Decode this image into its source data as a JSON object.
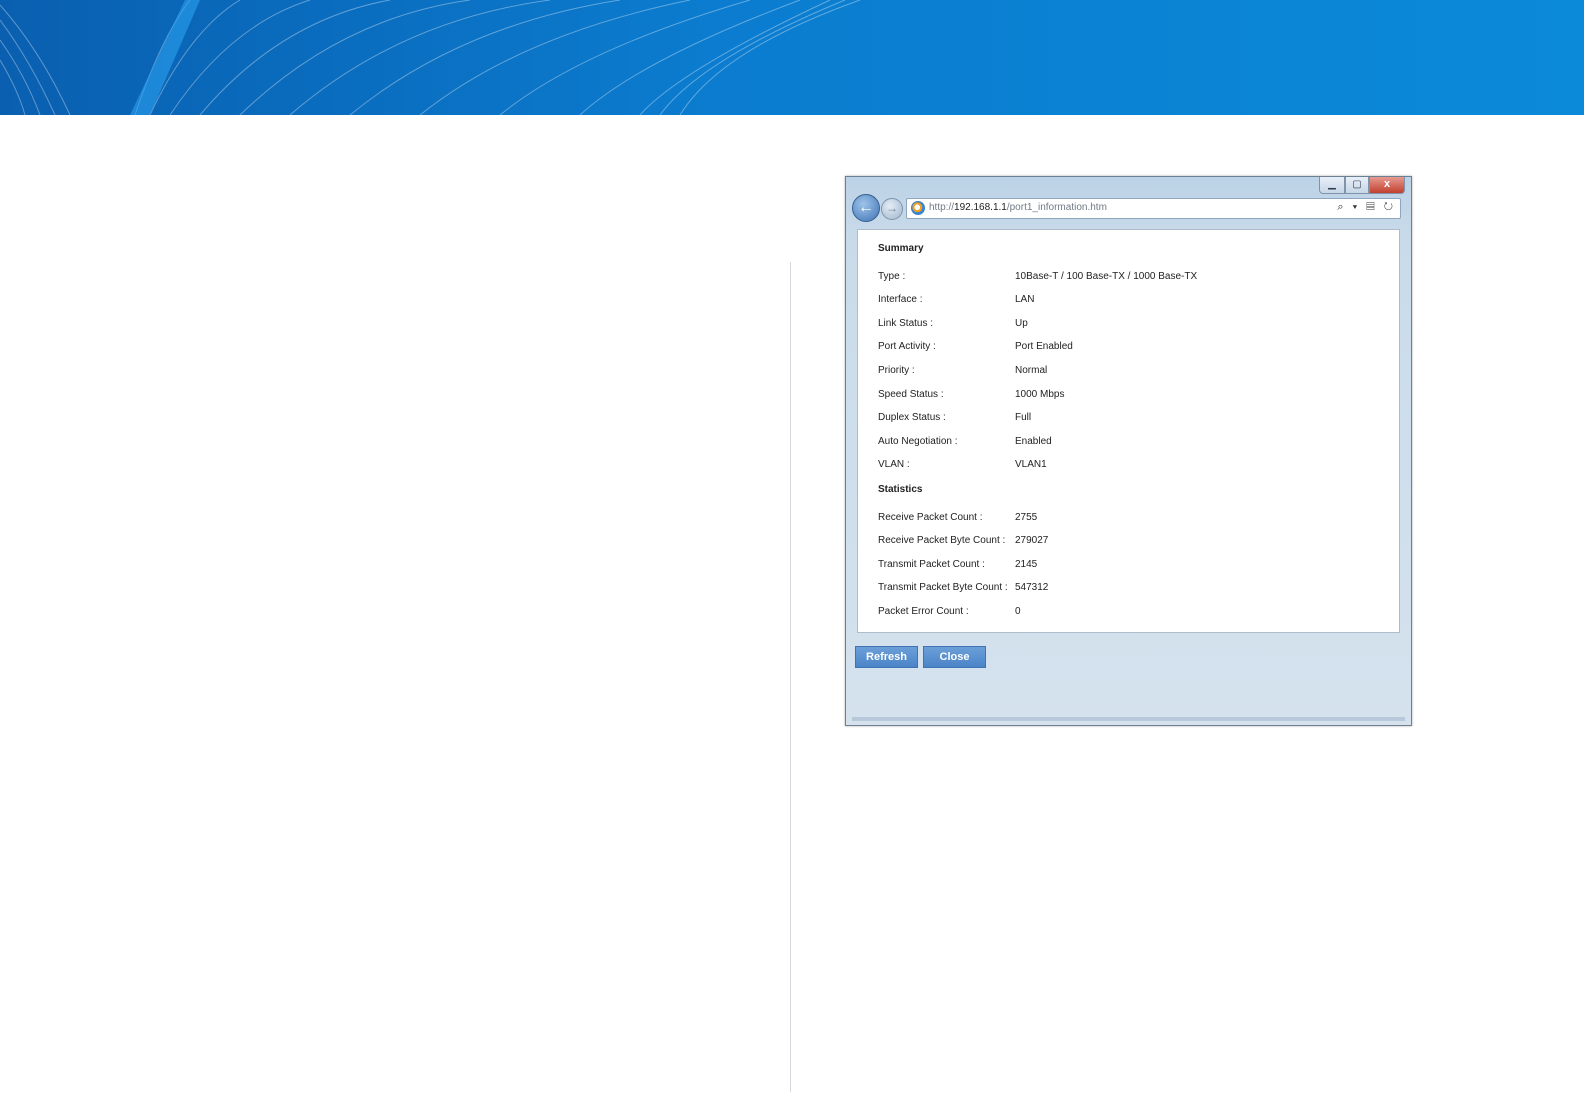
{
  "browser": {
    "close_glyph": "x",
    "url_prefix": "http://",
    "url_host": "192.168.1.1",
    "url_path": "/port1_information.htm",
    "address_tools": "⌕ ▾ ▤ ↻"
  },
  "summary": {
    "title": "Summary",
    "rows": [
      {
        "label": "Type :",
        "value": "10Base-T / 100 Base-TX / 1000 Base-TX"
      },
      {
        "label": "Interface :",
        "value": "LAN"
      },
      {
        "label": "Link Status :",
        "value": "Up"
      },
      {
        "label": "Port Activity :",
        "value": "Port Enabled"
      },
      {
        "label": "Priority :",
        "value": "Normal"
      },
      {
        "label": "Speed Status :",
        "value": "1000 Mbps"
      },
      {
        "label": "Duplex Status :",
        "value": "Full"
      },
      {
        "label": "Auto Negotiation :",
        "value": "Enabled"
      },
      {
        "label": "VLAN :",
        "value": "VLAN1"
      }
    ]
  },
  "statistics": {
    "title": "Statistics",
    "rows": [
      {
        "label": "Receive Packet Count :",
        "value": "2755"
      },
      {
        "label": "Receive Packet Byte Count :",
        "value": "279027"
      },
      {
        "label": "Transmit Packet Count :",
        "value": "2145"
      },
      {
        "label": "Transmit Packet Byte Count :",
        "value": "547312"
      },
      {
        "label": "Packet Error Count :",
        "value": "0"
      }
    ]
  },
  "buttons": {
    "refresh": "Refresh",
    "close": "Close"
  }
}
